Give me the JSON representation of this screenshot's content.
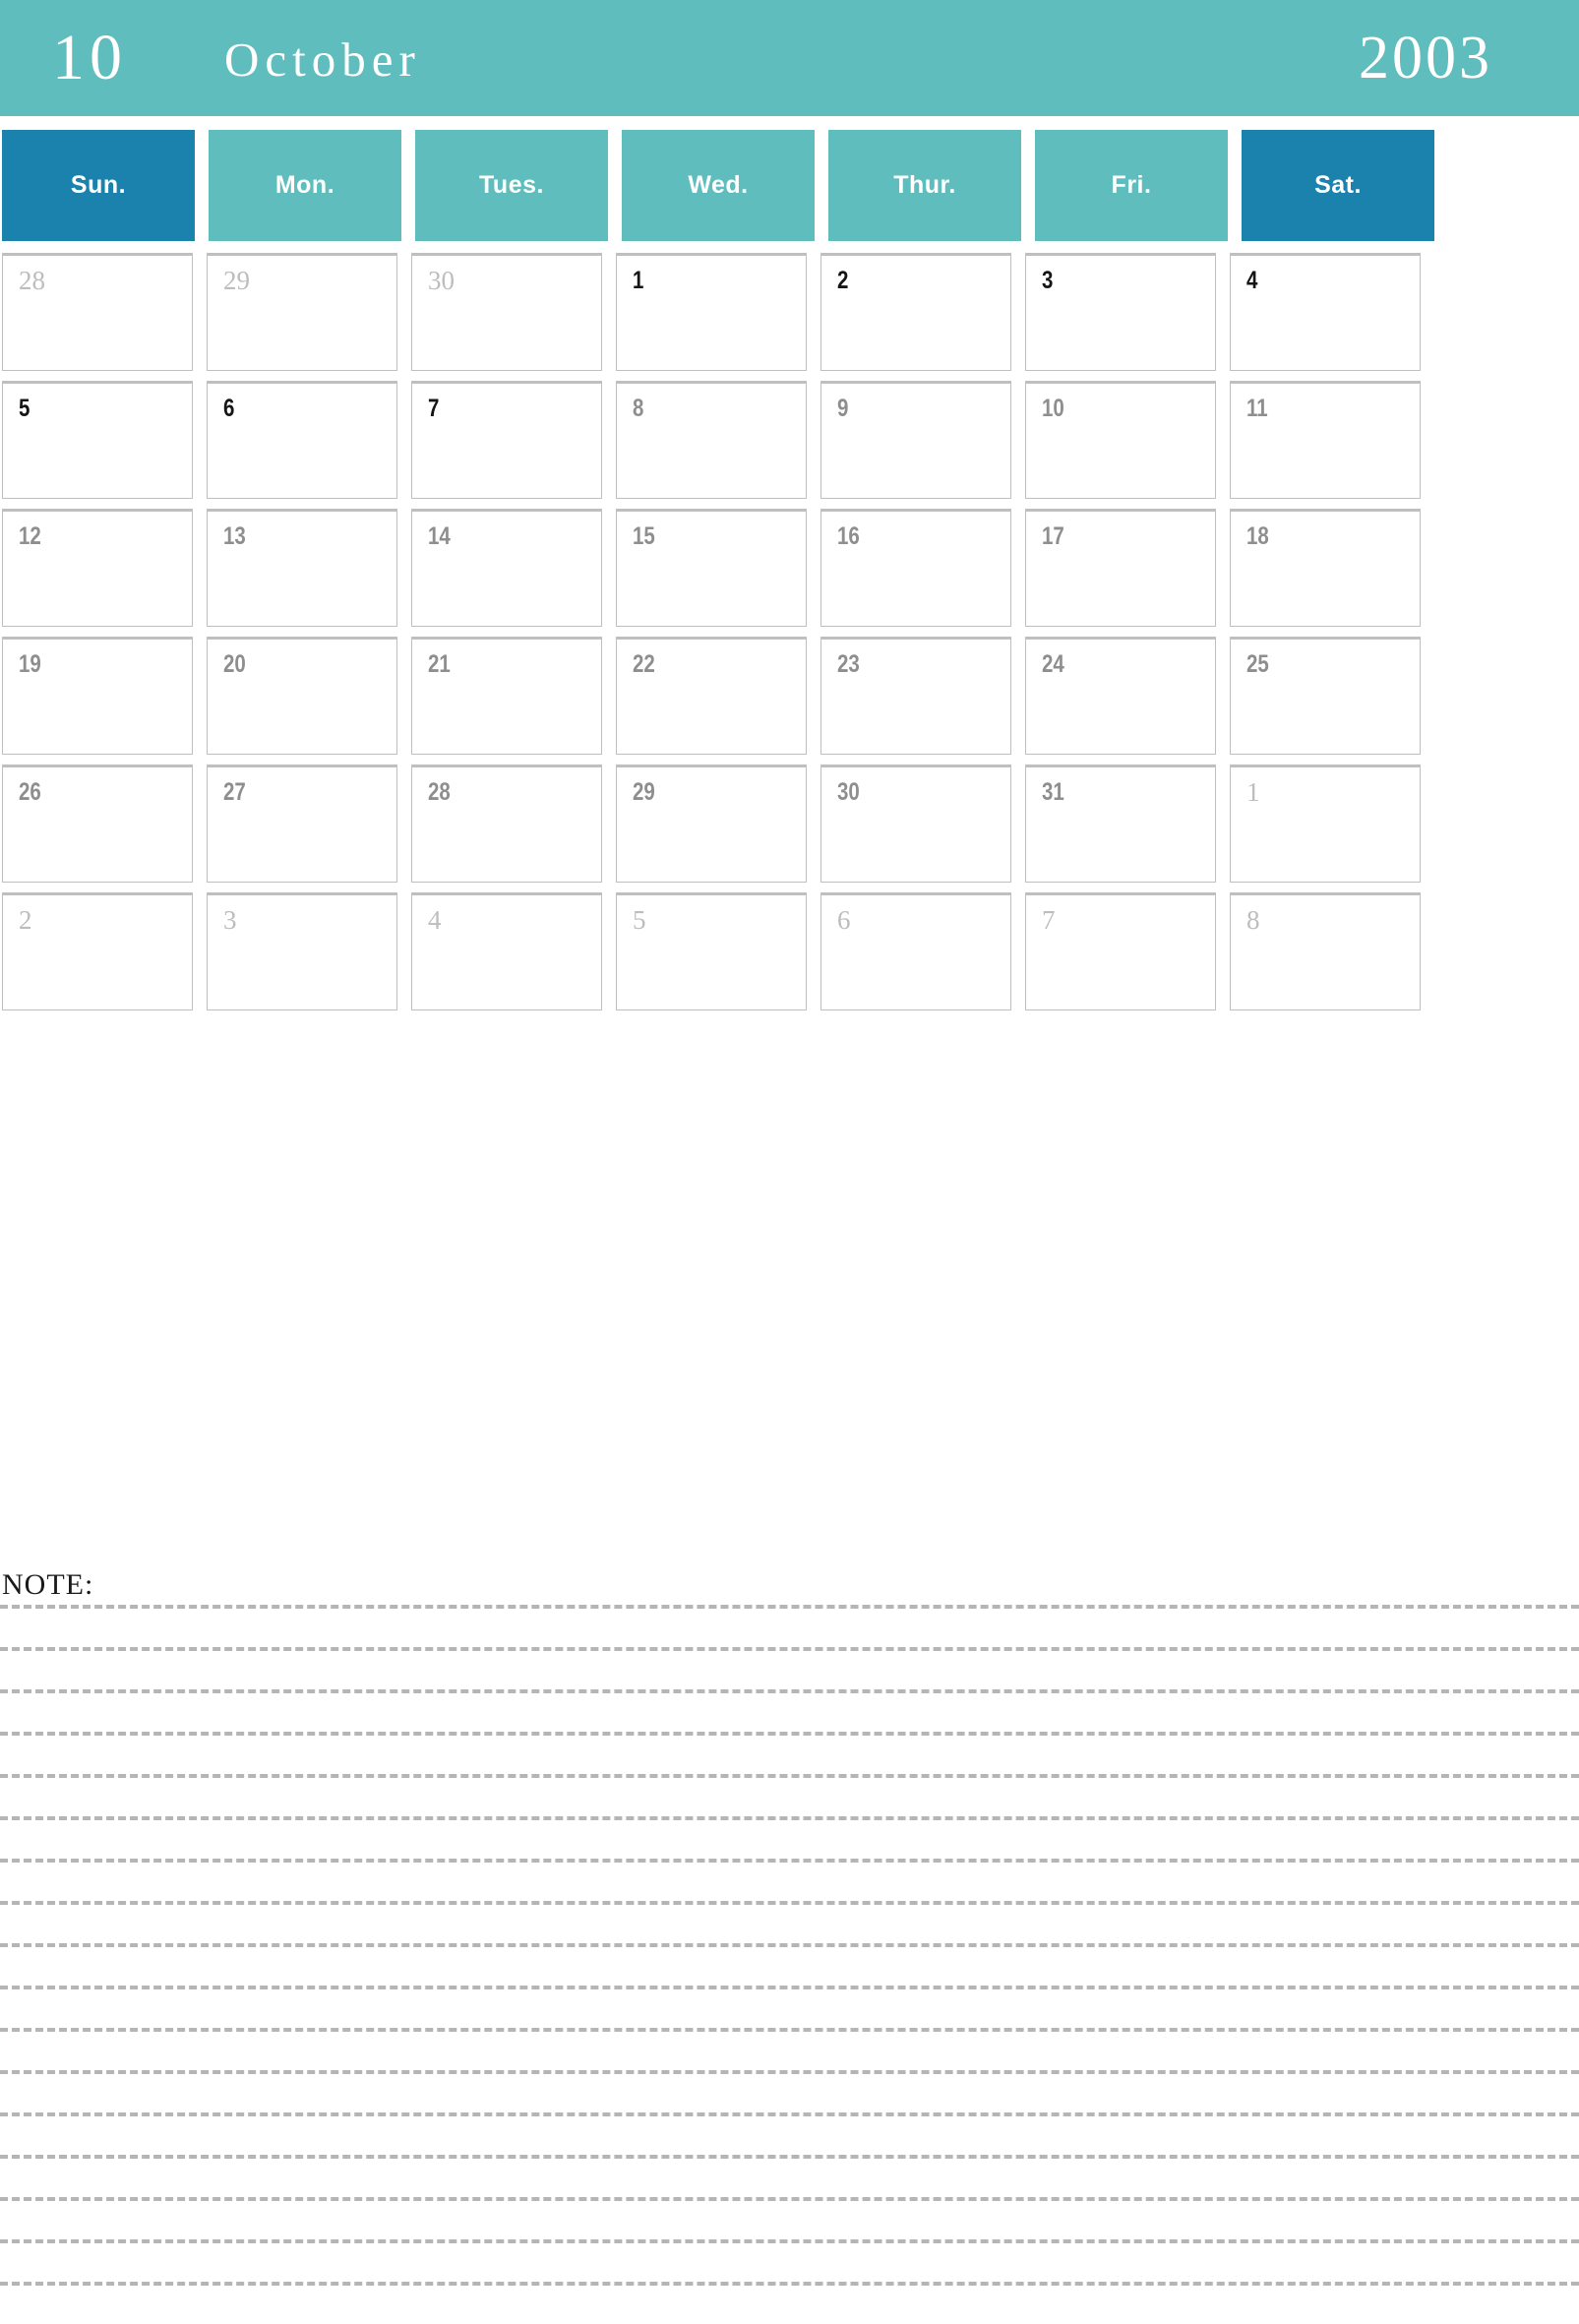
{
  "banner": {
    "month_number": "10",
    "month_name": "October",
    "year": "2003",
    "background_color": "#5FBDBD",
    "text_color": "#ffffff"
  },
  "colors": {
    "teal": "#5FBDBD",
    "blue": "#1B82AD",
    "cell_border": "#BFBFBF",
    "day_dark": "#151515",
    "day_gray": "#8E8E8E",
    "day_adjacent": "#BDBDBD",
    "note_line": "#B5B5B5"
  },
  "weekdays": [
    {
      "label": "Sun.",
      "weekend": true
    },
    {
      "label": "Mon.",
      "weekend": false
    },
    {
      "label": "Tues.",
      "weekend": false
    },
    {
      "label": "Wed.",
      "weekend": false
    },
    {
      "label": "Thur.",
      "weekend": false
    },
    {
      "label": "Fri.",
      "weekend": false
    },
    {
      "label": "Sat.",
      "weekend": true
    }
  ],
  "weeks": [
    [
      {
        "day": "28",
        "style": "adj"
      },
      {
        "day": "29",
        "style": "adj"
      },
      {
        "day": "30",
        "style": "adj"
      },
      {
        "day": "1",
        "style": "cur-dark"
      },
      {
        "day": "2",
        "style": "cur-dark"
      },
      {
        "day": "3",
        "style": "cur-dark"
      },
      {
        "day": "4",
        "style": "cur-dark"
      }
    ],
    [
      {
        "day": "5",
        "style": "cur-dark"
      },
      {
        "day": "6",
        "style": "cur-dark"
      },
      {
        "day": "7",
        "style": "cur-dark"
      },
      {
        "day": "8",
        "style": "cur-gray"
      },
      {
        "day": "9",
        "style": "cur-gray"
      },
      {
        "day": "10",
        "style": "cur-gray"
      },
      {
        "day": "11",
        "style": "cur-gray"
      }
    ],
    [
      {
        "day": "12",
        "style": "cur-gray"
      },
      {
        "day": "13",
        "style": "cur-gray"
      },
      {
        "day": "14",
        "style": "cur-gray"
      },
      {
        "day": "15",
        "style": "cur-gray"
      },
      {
        "day": "16",
        "style": "cur-gray"
      },
      {
        "day": "17",
        "style": "cur-gray"
      },
      {
        "day": "18",
        "style": "cur-gray"
      }
    ],
    [
      {
        "day": "19",
        "style": "cur-gray"
      },
      {
        "day": "20",
        "style": "cur-gray"
      },
      {
        "day": "21",
        "style": "cur-gray"
      },
      {
        "day": "22",
        "style": "cur-gray"
      },
      {
        "day": "23",
        "style": "cur-gray"
      },
      {
        "day": "24",
        "style": "cur-gray"
      },
      {
        "day": "25",
        "style": "cur-gray"
      }
    ],
    [
      {
        "day": "26",
        "style": "cur-gray"
      },
      {
        "day": "27",
        "style": "cur-gray"
      },
      {
        "day": "28",
        "style": "cur-gray"
      },
      {
        "day": "29",
        "style": "cur-gray"
      },
      {
        "day": "30",
        "style": "cur-gray"
      },
      {
        "day": "31",
        "style": "cur-gray"
      },
      {
        "day": "1",
        "style": "adj"
      }
    ],
    [
      {
        "day": "2",
        "style": "adj"
      },
      {
        "day": "3",
        "style": "adj"
      },
      {
        "day": "4",
        "style": "adj"
      },
      {
        "day": "5",
        "style": "adj"
      },
      {
        "day": "6",
        "style": "adj"
      },
      {
        "day": "7",
        "style": "adj"
      },
      {
        "day": "8",
        "style": "adj"
      }
    ]
  ],
  "note": {
    "label": "NOTE:",
    "line_count": 17
  }
}
